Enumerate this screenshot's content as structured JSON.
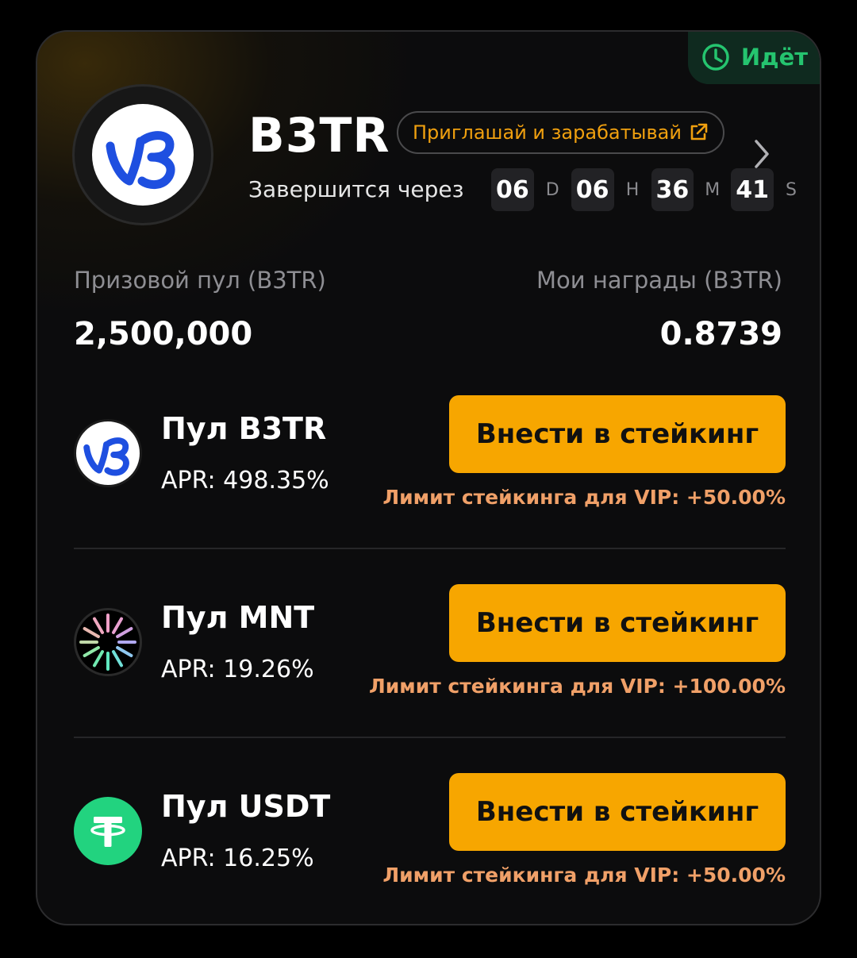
{
  "status": {
    "label": "Идёт",
    "icon": "clock-icon",
    "color": "#25c46f"
  },
  "header": {
    "token": "B3TR",
    "invite_label": "Приглашай и зарабатывай",
    "ends_label": "Завершится через",
    "countdown": [
      {
        "value": "06",
        "unit": "D"
      },
      {
        "value": "06",
        "unit": "H"
      },
      {
        "value": "36",
        "unit": "M"
      },
      {
        "value": "41",
        "unit": "S"
      }
    ]
  },
  "stats": {
    "prize_pool_label": "Призовой пул (B3TR)",
    "prize_pool_value": "2,500,000",
    "my_rewards_label": "Мои награды (B3TR)",
    "my_rewards_value": "0.8739"
  },
  "pools": [
    {
      "name": "Пул B3TR",
      "apr": "APR: 498.35%",
      "button": "Внести в стейкинг",
      "vip_limit": "Лимит стейкинга для VIP: +50.00%",
      "icon": "b3tr-logo-icon"
    },
    {
      "name": "Пул MNT",
      "apr": "APR: 19.26%",
      "button": "Внести в стейкинг",
      "vip_limit": "Лимит стейкинга для VIP: +100.00%",
      "icon": "mnt-logo-icon"
    },
    {
      "name": "Пул USDT",
      "apr": "APR: 16.25%",
      "button": "Внести в стейкинг",
      "vip_limit": "Лимит стейкинга для VIP: +50.00%",
      "icon": "usdt-logo-icon"
    }
  ],
  "colors": {
    "accent": "#f7a600",
    "vip_text": "#f0a068",
    "background": "#0c0c0d"
  }
}
